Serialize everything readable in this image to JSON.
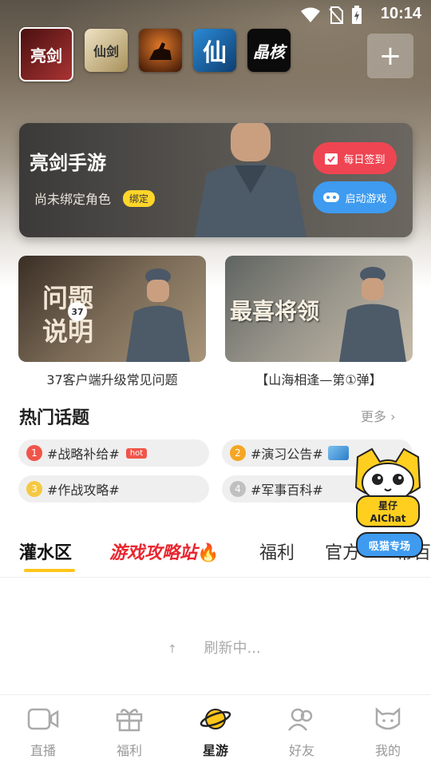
{
  "status": {
    "time": "10:14"
  },
  "games": [
    {
      "name": "亮剑",
      "color": "#7a1d1d"
    },
    {
      "name": "仙剑",
      "color": "#c8b27a"
    },
    {
      "name": "骑兵",
      "color": "#8a3a12"
    },
    {
      "name": "仙",
      "color": "#1e6fb0"
    },
    {
      "name": "晶核",
      "color": "#111111"
    }
  ],
  "card": {
    "title": "亮剑手游",
    "sub": "尚未绑定角色",
    "bind": "绑定",
    "sign_label": "每日签到",
    "start_label": "启动游戏"
  },
  "banners": [
    {
      "overlay_line1": "问题",
      "overlay_line2": "说明",
      "tag": "37",
      "caption": "37客户端升级常见问题"
    },
    {
      "overlay": "最喜将领",
      "caption": "【山海相逢—第①弹】"
    }
  ],
  "hot_topics": {
    "title": "热门话题",
    "more": "更多",
    "items": [
      {
        "rank": "1",
        "text": "#战略补给#",
        "badge": "hot",
        "color": "#f0554a"
      },
      {
        "rank": "2",
        "text": "#演习公告#",
        "color": "#f5a623"
      },
      {
        "rank": "3",
        "text": "#作战攻略#",
        "color": "#f5c842"
      },
      {
        "rank": "4",
        "text": "#军事百科#",
        "color": "#c0c0c0"
      }
    ]
  },
  "tabs": [
    "灌水区",
    "游戏攻略站",
    "福利",
    "官方",
    "幕百"
  ],
  "refresh_text": "刷新中...",
  "mascot": {
    "label1": "星仔",
    "label2": "AIChat",
    "label3": "吸猫专场"
  },
  "nav": [
    "直播",
    "福利",
    "星游",
    "好友",
    "我的"
  ],
  "colors": {
    "accent": "#ffc61a",
    "hot": "#f0554a"
  }
}
